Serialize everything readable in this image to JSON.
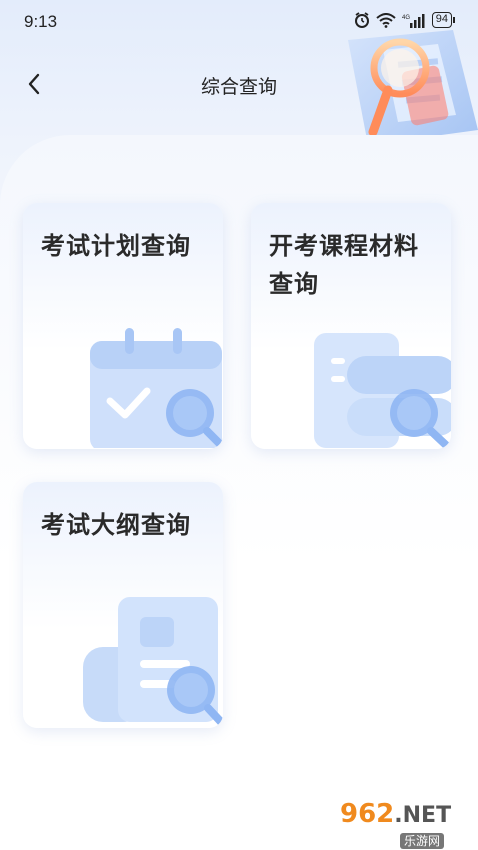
{
  "status_bar": {
    "time": "9:13",
    "signal_label": "4G",
    "battery": "94"
  },
  "nav": {
    "title": "综合查询"
  },
  "cards": [
    {
      "title": "考试计划查询"
    },
    {
      "title": "开考课程材料查询"
    },
    {
      "title": "考试大纲查询"
    }
  ],
  "watermark": {
    "brand": "962",
    "tld": ".NET",
    "subtitle": "乐游网"
  },
  "colors": {
    "accent_blue": "#8fb6f3",
    "title_text": "#2a2a2a"
  }
}
